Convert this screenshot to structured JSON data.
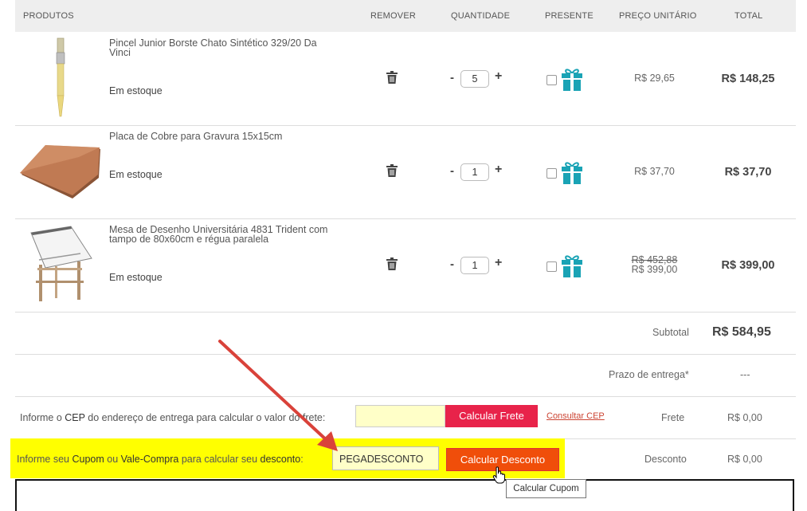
{
  "header": {
    "produtos": "PRODUTOS",
    "remover": "REMOVER",
    "quantidade": "QUANTIDADE",
    "presente": "PRESENTE",
    "preco_unitario": "PREÇO UNITÁRIO",
    "total": "TOTAL"
  },
  "items": [
    {
      "name": "Pincel Junior Borste Chato Sintético 329/20 Da Vinci",
      "stock": "Em estoque",
      "quantity": "5",
      "old_price": "",
      "unit_price": "R$ 29,65",
      "total": "R$ 148,25",
      "gift_checked": false
    },
    {
      "name": "Placa de Cobre para Gravura 15x15cm",
      "stock": "Em estoque",
      "quantity": "1",
      "old_price": "",
      "unit_price": "R$ 37,70",
      "total": "R$ 37,70",
      "gift_checked": false
    },
    {
      "name": "Mesa de Desenho Universitária 4831 Trident com tampo de 80x60cm e régua paralela",
      "stock": "Em estoque",
      "quantity": "1",
      "old_price": "R$ 452,88",
      "unit_price": "R$ 399,00",
      "total": "R$ 399,00",
      "gift_checked": false
    }
  ],
  "qty_controls": {
    "minus": "-",
    "plus": "+"
  },
  "summary": {
    "subtotal_label": "Subtotal",
    "subtotal_value": "R$ 584,95",
    "prazo_label": "Prazo de entrega*",
    "prazo_value": "---",
    "frete_label": "Frete",
    "frete_value": "R$ 0,00",
    "desconto_label": "Desconto",
    "desconto_value": "R$ 0,00"
  },
  "shipping": {
    "text_before": "Informe o ",
    "text_bold": "CEP",
    "text_after": " do endereço de entrega para calcular o valor do frete:",
    "cep_value": "",
    "button": "Calcular Frete",
    "consult_link": "Consultar CEP"
  },
  "coupon": {
    "t1": "Informe seu ",
    "t2": "Cupom",
    "t3": " ou ",
    "t4": "Vale-Compra",
    "t5": " para calcular seu ",
    "t6": "desconto",
    "t7": ":",
    "value": "PEGADESCONTO",
    "button": "Calcular Desconto",
    "tooltip": "Calcular Cupom"
  },
  "colors": {
    "frete_button": "#e8234a",
    "desconto_button": "#f04e0a",
    "highlight": "#ffff00",
    "gift": "#1aa3b5",
    "arrow": "#d9423a"
  },
  "icons": {
    "trash": "trash-icon",
    "gift": "gift-icon",
    "calendar": "address-book-icon",
    "cursor": "hand-pointer-icon"
  }
}
